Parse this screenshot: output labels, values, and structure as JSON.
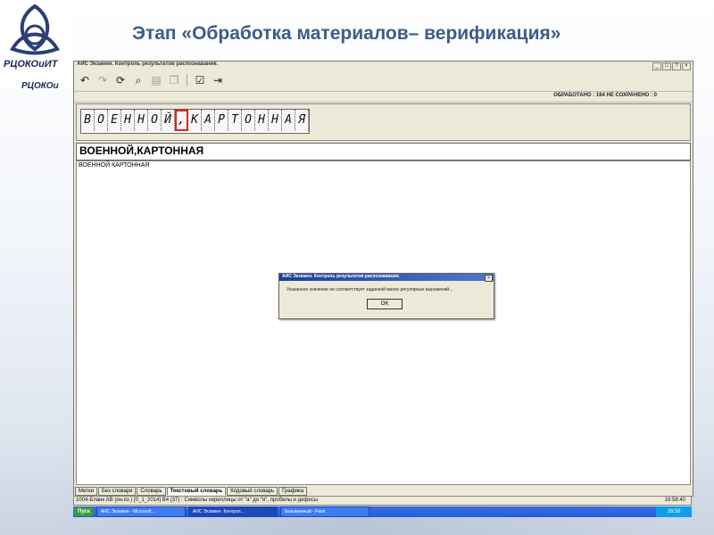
{
  "logo": {
    "text1": "РЦОКОиИТ",
    "text2": "РЦОКОи"
  },
  "slide_title": "Этап «Обработка материалов– верификация»",
  "app": {
    "title": "АИС Экзамен. Контроль результатов распознавания.",
    "window_buttons": [
      "_",
      "□",
      "?",
      "×"
    ],
    "toolbar": [
      "undo-icon",
      "redo-icon",
      "refresh-icon",
      "search-icon",
      "paste-icon",
      "copy-icon",
      "check-icon",
      "exit-icon"
    ],
    "status": "ОБРАБОТАНО : 164   НЕ СОХРАНЕНО : 0",
    "image_chars": [
      "В",
      "О",
      "Е",
      "Н",
      "Н",
      "О",
      "Й",
      ",",
      "К",
      "А",
      "Р",
      "Т",
      "О",
      "Н",
      "Н",
      "А",
      "Я"
    ],
    "highlight_index": 7,
    "recognized_text": "ВОЕННОЙ,КАРТОННАЯ",
    "work_text": "ВОЕННОЙ КАРТОННАЯ",
    "tabs": [
      "Метки",
      "Без словаря",
      "Словарь",
      "Текстовый словарь",
      "Кодовый словарь",
      "Графика"
    ],
    "active_tab": 3
  },
  "dialog": {
    "title": "АИС Экзамен. Контроль результатов распознавания.",
    "close": "×",
    "message": "Указанное значение не соответствует заданной маске регулярных выражений...",
    "ok": "OK"
  },
  "statusbar": {
    "left": "1004-Бланк АВ (ин.яз.) [0_1_2014]   В4 (37) : Символы кириллицы от \"а\" до \"я\", пробелы и дефисы",
    "time": "16:58:40"
  },
  "taskbar": {
    "start": "Пуск",
    "tasks": [
      "АИС Экзамен - Microsoft...",
      "АИС Экзамен. Контрол...",
      "Безымянный - Paint"
    ],
    "active_task": 1,
    "clock": "16:58"
  }
}
